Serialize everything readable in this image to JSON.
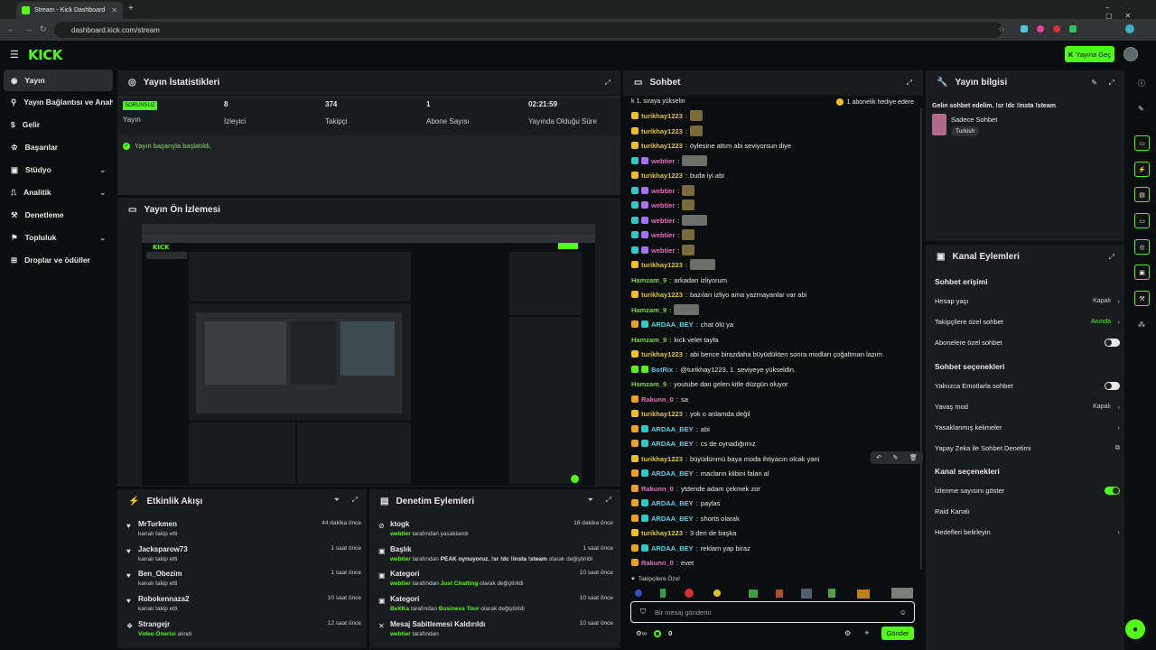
{
  "browser": {
    "tab_title": "Stream - Kick Dashboard",
    "url": "dashboard.kick.com/stream"
  },
  "header": {
    "logo": "KICK",
    "go_live": "Yayına Geç"
  },
  "sidebar": {
    "items": [
      {
        "label": "Yayın"
      },
      {
        "label": "Yayın Bağlantısı ve Anahtarı"
      },
      {
        "label": "Gelir"
      },
      {
        "label": "Başarılar"
      },
      {
        "label": "Stüdyo"
      },
      {
        "label": "Analitik"
      },
      {
        "label": "Denetleme"
      },
      {
        "label": "Topluluk"
      },
      {
        "label": "Droplar ve ödüller"
      }
    ]
  },
  "stats": {
    "title": "Yayın İstatistikleri",
    "status_badge": "SORUNSUZ",
    "status_label": "Yayın",
    "viewers_value": "8",
    "viewers_label": "İzleyici",
    "followers_value": "374",
    "followers_label": "Takipçi",
    "subs_value": "1",
    "subs_label": "Abone Sayısı",
    "uptime_value": "02:21:59",
    "uptime_label": "Yayında Olduğu Süre",
    "success_msg": "Yayın başarıyla başlatıldı."
  },
  "preview": {
    "title": "Yayın Ön İzlemesi"
  },
  "activity": {
    "title": "Etkinlik Akışı",
    "items": [
      {
        "name": "MrTurkmen",
        "sub": "kanalı takip etti",
        "time": "44 dakika önce"
      },
      {
        "name": "Jacksparow73",
        "sub": "kanalı takip etti",
        "time": "1 saat önce"
      },
      {
        "name": "Ben_Obezim",
        "sub": "kanalı takip etti",
        "time": "1 saat önce"
      },
      {
        "name": "Robokennaza2",
        "sub": "kanalı takip etti",
        "time": "10 saat önce"
      },
      {
        "name": "Strangejr",
        "sub_green": "Video Önerisi",
        "sub": "alındı",
        "time": "12 saat önce"
      }
    ]
  },
  "moderation": {
    "title": "Denetim Eylemleri",
    "items": [
      {
        "name": "ktogk",
        "actor": "webtier",
        "rest": "tarafından yasaklandı",
        "time": "16 dakika önce"
      },
      {
        "name": "Başlık",
        "actor": "webtier",
        "mid": "tarafından",
        "hl": "PEAK oynuyoruz. !sr !dc !insta !steam",
        "rest": "olarak değiştirildi",
        "time": "1 saat önce"
      },
      {
        "name": "Kategori",
        "actor": "webtier",
        "mid": "tarafından",
        "hlg": "Just Chatting",
        "rest": "olarak değiştirildi",
        "time": "10 saat önce"
      },
      {
        "name": "Kategori",
        "actor": "BeXKa",
        "mid": "tarafından",
        "hlg": "Business Tour",
        "rest": "olarak değiştirildi",
        "time": "10 saat önce"
      },
      {
        "name": "Mesaj Sabitlemesi Kaldırıldı",
        "actor": "webtier",
        "rest": "tarafından",
        "time": "10 saat önce"
      }
    ]
  },
  "chat": {
    "title": "Sohbet",
    "top_left": "k 1. sıraya yükselin",
    "top_right": "1 abonelik hediye edere",
    "messages": [
      {
        "user": "turikhay1223",
        "color": "yellow",
        "badge": "yellow",
        "text": "",
        "emote": "em"
      },
      {
        "user": "turikhay1223",
        "color": "yellow",
        "badge": "yellow",
        "text": "",
        "emote": "em"
      },
      {
        "user": "turikhay1223",
        "color": "yellow",
        "badge": "yellow",
        "text": "öylesine attım abi seviyorsun diye"
      },
      {
        "user": "webtier",
        "color": "pink",
        "badge": "cyan",
        "text": "",
        "emote": "em2"
      },
      {
        "user": "turikhay1223",
        "color": "yellow",
        "badge": "yellow",
        "text": "buda iyi abi"
      },
      {
        "user": "webtier",
        "color": "pink",
        "badge": "cyan",
        "text": "",
        "emote": "em"
      },
      {
        "user": "webtier",
        "color": "pink",
        "badge": "cyan",
        "text": "",
        "emote": "em"
      },
      {
        "user": "webtier",
        "color": "pink",
        "badge": "cyan",
        "text": "",
        "emote": "em2"
      },
      {
        "user": "webtier",
        "color": "pink",
        "badge": "cyan",
        "text": "",
        "emote": "em"
      },
      {
        "user": "webtier",
        "color": "pink",
        "badge": "cyan",
        "text": "",
        "emote": "em"
      },
      {
        "user": "turikhay1223",
        "color": "yellow",
        "badge": "yellow",
        "text": "",
        "emote": "em2"
      },
      {
        "user": "Hamzam_9",
        "color": "lgreen",
        "badge": "",
        "text": "arkadan izliyorum"
      },
      {
        "user": "turikhay1223",
        "color": "yellow",
        "badge": "yellow",
        "text": "bazıları izliyo ama yazmayanlar var abi"
      },
      {
        "user": "Hamzam_9",
        "color": "lgreen",
        "badge": "",
        "text": "",
        "emote": "em2"
      },
      {
        "user": "ARDAA_BEY",
        "color": "cyan",
        "badge": "orange",
        "text": "chat ölü ya"
      },
      {
        "user": "Hamzam_9",
        "color": "lgreen",
        "badge": "",
        "text": "kick velet tayfa"
      },
      {
        "user": "turikhay1223",
        "color": "yellow",
        "badge": "yellow",
        "text": "abi bence birazdaha büyüdükten sonra modları çoğaltman lazım"
      },
      {
        "user": "BotRix",
        "color": "lblue",
        "badge": "green",
        "text": "@turikhay1223, 1. seviyeye yükseldin."
      },
      {
        "user": "Hamzam_9",
        "color": "lgreen",
        "badge": "",
        "text": "youtube dan gelen kitle düzgün oluyor"
      },
      {
        "user": "Rakunn_0",
        "color": "pink",
        "badge": "orange",
        "text": "sa"
      },
      {
        "user": "turikhay1223",
        "color": "yellow",
        "badge": "yellow",
        "text": "yok o anlamda değil"
      },
      {
        "user": "ARDAA_BEY",
        "color": "cyan",
        "badge": "orange",
        "text": "abi"
      },
      {
        "user": "ARDAA_BEY",
        "color": "cyan",
        "badge": "orange",
        "text": "cs de oynadığımız"
      },
      {
        "user": "turikhay1223",
        "color": "yellow",
        "badge": "yellow",
        "text": "büyüdünmü baya moda ihtiyacın olcak yani"
      },
      {
        "user": "ARDAA_BEY",
        "color": "cyan",
        "badge": "orange",
        "text": "macların klibini falan al"
      },
      {
        "user": "Rakunn_0",
        "color": "pink",
        "badge": "orange",
        "text": "ytdende adam çekmek zor"
      },
      {
        "user": "ARDAA_BEY",
        "color": "cyan",
        "badge": "orange",
        "text": "paylas"
      },
      {
        "user": "ARDAA_BEY",
        "color": "cyan",
        "badge": "orange",
        "text": "shorts olarak"
      },
      {
        "user": "turikhay1223",
        "color": "yellow",
        "badge": "yellow",
        "text": "3 den de başka"
      },
      {
        "user": "ARDAA_BEY",
        "color": "cyan",
        "badge": "orange",
        "text": "reklam yap biraz"
      },
      {
        "user": "Rakunn_0",
        "color": "pink",
        "badge": "orange",
        "text": "evet"
      }
    ],
    "followers_only_label": "Takipçilere Özel",
    "input_placeholder": "Bir mesaj gönderin",
    "points": "0",
    "send": "Gönder"
  },
  "stream_info": {
    "title": "Yayın bilgisi",
    "stream_title": "Gelin sohbet edelim. !sr !dc !insta !steam",
    "category": "Sadece Sohbet",
    "tag": "Turkish"
  },
  "channel_actions": {
    "title": "Kanal Eylemleri",
    "chat_access": "Sohbet erişimi",
    "account_age": "Hesap yaşı",
    "account_age_val": "Kapalı",
    "followers_chat": "Takipçilere özel sohbet",
    "followers_chat_val": "Anında",
    "subs_chat": "Abonelere özel sohbet",
    "chat_options": "Sohbet seçenekleri",
    "emotes_only": "Yalnızca Emotlarla sohbet",
    "slow_mode": "Yavaş mod",
    "slow_mode_val": "Kapalı",
    "banned_words": "Yasaklanmış kelimeler",
    "ai_mod": "Yapay Zeka ile Sohbet Denetimi",
    "channel_options": "Kanal seçenekleri",
    "show_viewers": "İzlenme sayısını göster",
    "raid": "Raid Kanalı",
    "targets": "Hedefleri belirleyin"
  },
  "colors": {
    "accent": "#53fc18",
    "panel": "#191b1f",
    "background": "#0b0e0f"
  }
}
